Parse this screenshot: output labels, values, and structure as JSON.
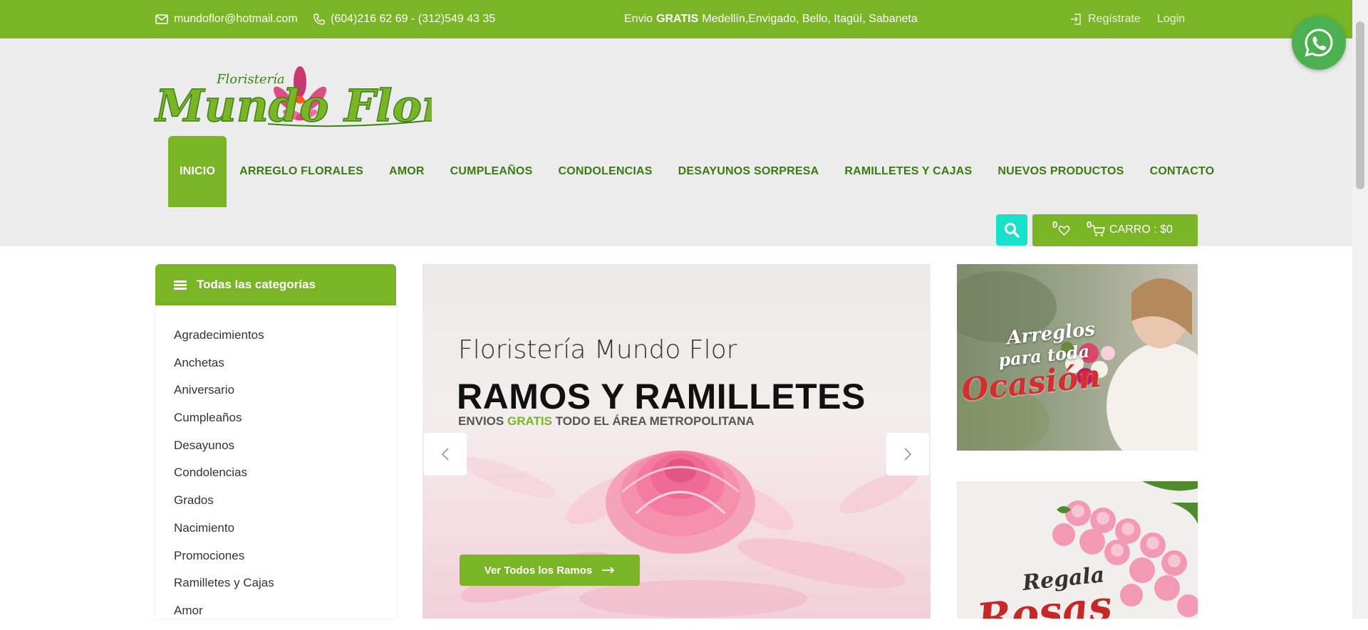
{
  "topbar": {
    "email": "mundoflor@hotmail.com",
    "phone": "(604)216 62 69 - (312)549 43 35",
    "shipping_prefix": "Envio",
    "shipping_bold": "GRATIS",
    "shipping_rest": "Medellín,Envigado, Bello, Itagüí, Sabaneta",
    "register": "Regístrate",
    "login": "Login"
  },
  "logo": {
    "small_text": "Floristería",
    "main_text": "Mundo Flor"
  },
  "nav": [
    "INICIO",
    "ARREGLO FLORALES",
    "AMOR",
    "CUMPLEAÑOS",
    "CONDOLENCIAS",
    "DESAYUNOS SORPRESA",
    "RAMILLETES Y CAJAS",
    "NUEVOS PRODUCTOS",
    "CONTACTO"
  ],
  "cart": {
    "wishlist_count": "0",
    "cart_count": "0",
    "label": "CARRO : $0"
  },
  "sidebar": {
    "title": "Todas las categorías",
    "items": [
      "Agradecimientos",
      "Anchetas",
      "Aniversario",
      "Cumpleaños",
      "Desayunos",
      "Condolencias",
      "Grados",
      "Nacimiento",
      "Promociones",
      "Ramilletes y Cajas",
      "Amor"
    ]
  },
  "slider": {
    "subtitle": "Floristería Mundo Flor",
    "title": "RAMOS Y RAMILLETES",
    "tagline_pre": "ENVIOS",
    "tagline_highlight": "GRATIS",
    "tagline_post": "TODO EL ÁREA METROPOLITANA",
    "button": "Ver Todos los Ramos"
  },
  "banners": {
    "b1_line1": "Arreglos",
    "b1_line2": "para toda",
    "b1_line3": "Ocasión",
    "b2_line1": "Regala",
    "b2_line2": "Rosas"
  },
  "colors": {
    "brand_green": "#7ab526",
    "nav_text": "#3a7a12",
    "search_teal": "#18e0c9",
    "whatsapp": "#4caf50"
  }
}
